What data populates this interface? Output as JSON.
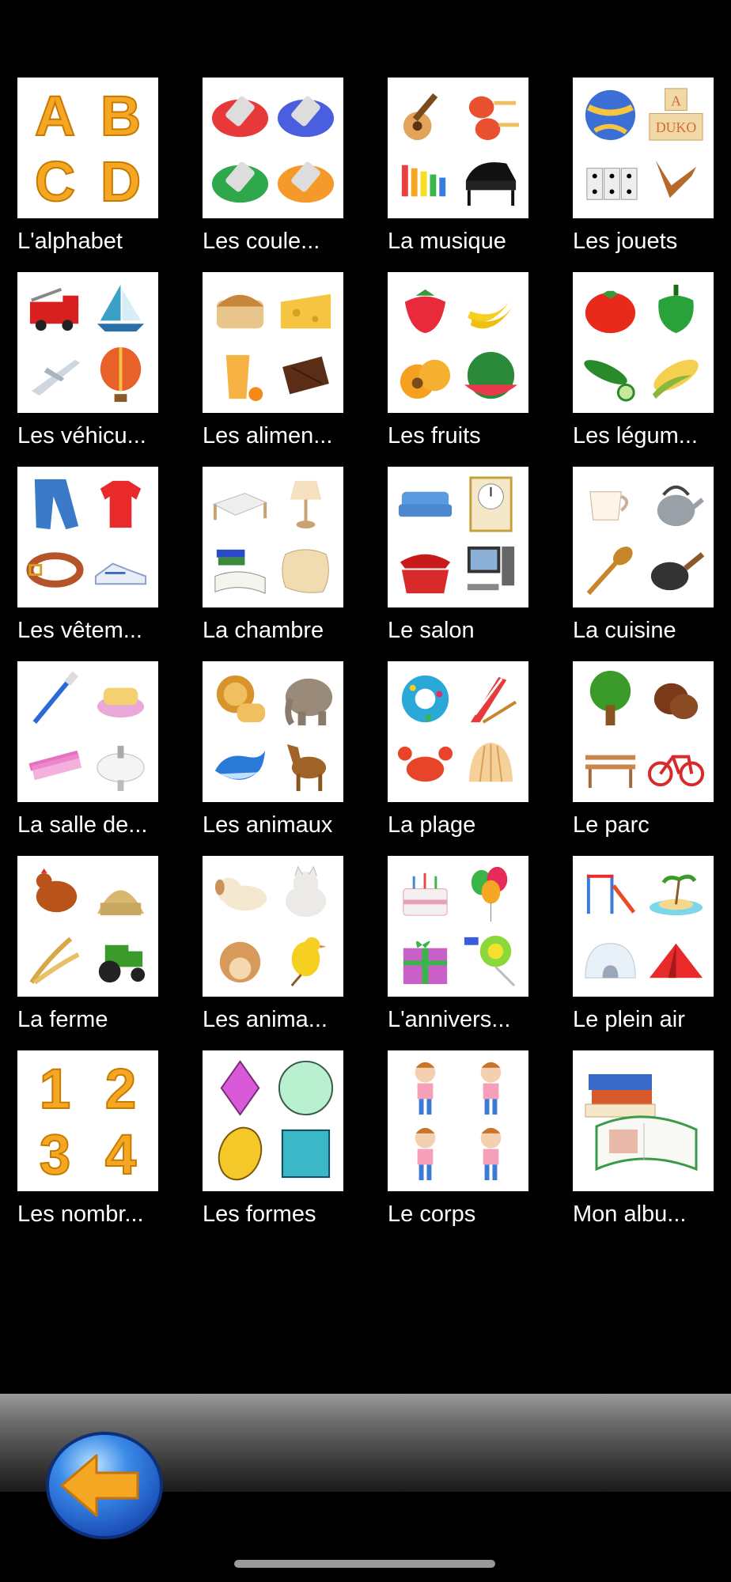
{
  "categories": [
    {
      "label": "L'alphabet",
      "icons": [
        "letter-a-icon",
        "letter-b-icon",
        "letter-c-icon",
        "letter-d-icon"
      ]
    },
    {
      "label": "Les coule...",
      "icons": [
        "red-paint-tube-icon",
        "blue-paint-tube-icon",
        "green-paint-tube-icon",
        "orange-paint-tube-icon"
      ]
    },
    {
      "label": "La musique",
      "icons": [
        "guitar-icon",
        "maracas-icon",
        "xylophone-icon",
        "piano-icon"
      ]
    },
    {
      "label": "Les jouets",
      "icons": [
        "ball-icon",
        "blocks-icon",
        "dominoes-icon",
        "boomerang-icon"
      ]
    },
    {
      "label": "Les véhicu...",
      "icons": [
        "fire-truck-icon",
        "sailboat-icon",
        "airplane-icon",
        "hot-air-balloon-icon"
      ]
    },
    {
      "label": "Les alimen...",
      "icons": [
        "bread-icon",
        "cheese-icon",
        "juice-icon",
        "chocolate-icon"
      ]
    },
    {
      "label": "Les fruits",
      "icons": [
        "strawberry-icon",
        "banana-icon",
        "apricot-icon",
        "watermelon-icon"
      ]
    },
    {
      "label": "Les légum...",
      "icons": [
        "tomato-icon",
        "pepper-icon",
        "cucumber-icon",
        "corn-icon"
      ]
    },
    {
      "label": "Les vêtem...",
      "icons": [
        "jeans-icon",
        "tshirt-icon",
        "belt-icon",
        "sneakers-icon"
      ]
    },
    {
      "label": "La chambre",
      "icons": [
        "bed-icon",
        "lamp-icon",
        "books-icon",
        "pillow-icon"
      ]
    },
    {
      "label": "Le salon",
      "icons": [
        "sofa-icon",
        "clock-icon",
        "telephone-icon",
        "computer-icon"
      ]
    },
    {
      "label": "La cuisine",
      "icons": [
        "cup-icon",
        "kettle-icon",
        "wooden-spoon-icon",
        "frying-pan-icon"
      ]
    },
    {
      "label": "La salle de...",
      "icons": [
        "toothbrush-icon",
        "soap-icon",
        "comb-icon",
        "sink-icon"
      ]
    },
    {
      "label": "Les animaux",
      "icons": [
        "lion-icon",
        "elephant-icon",
        "whale-icon",
        "horse-icon"
      ]
    },
    {
      "label": "La plage",
      "icons": [
        "swim-ring-icon",
        "deck-chair-icon",
        "crab-icon",
        "seashell-icon"
      ]
    },
    {
      "label": "Le parc",
      "icons": [
        "tree-icon",
        "chestnut-icon",
        "bench-icon",
        "bicycle-icon"
      ]
    },
    {
      "label": "La ferme",
      "icons": [
        "hen-icon",
        "hay-bale-icon",
        "wheat-icon",
        "tractor-icon"
      ]
    },
    {
      "label": "Les anima...",
      "icons": [
        "dog-icon",
        "cat-icon",
        "hamster-icon",
        "canary-icon"
      ]
    },
    {
      "label": "L'annivers...",
      "icons": [
        "birthday-cake-icon",
        "balloons-icon",
        "gift-icon",
        "lollipop-icon"
      ]
    },
    {
      "label": "Le plein air",
      "icons": [
        "playground-icon",
        "island-icon",
        "igloo-icon",
        "tent-icon"
      ]
    },
    {
      "label": "Les nombr...",
      "icons": [
        "number-1-icon",
        "number-2-icon",
        "number-3-icon",
        "number-4-icon"
      ]
    },
    {
      "label": "Les formes",
      "icons": [
        "diamond-shape-icon",
        "circle-shape-icon",
        "oval-shape-icon",
        "square-shape-icon"
      ]
    },
    {
      "label": "Le corps",
      "icons": [
        "girl-icon",
        "girl-icon",
        "girl-icon",
        "girl-icon"
      ]
    },
    {
      "label": "Mon albu...",
      "icons": [
        "photo-album-icon"
      ]
    }
  ],
  "back_button": {
    "icon": "back-arrow-icon"
  },
  "colors": {
    "background": "#000000",
    "label": "#ffffff",
    "letter_fill": "#f5a623",
    "back_button_blue": "#2f7fe0",
    "back_arrow": "#f5a623"
  }
}
